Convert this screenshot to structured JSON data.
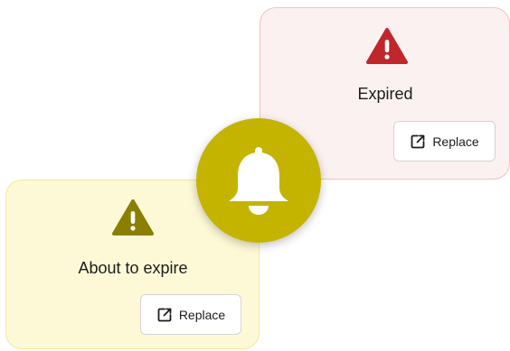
{
  "colors": {
    "expired_accent": "#c0272d",
    "expiring_accent": "#8a7f00",
    "bell_badge": "#c4b400"
  },
  "notification_icon": "bell-icon",
  "cards": {
    "expired": {
      "title": "Expired",
      "icon": "warning-icon",
      "button": {
        "label": "Replace",
        "icon": "open-external-icon"
      }
    },
    "about_to_expire": {
      "title": "About to expire",
      "icon": "warning-icon",
      "button": {
        "label": "Replace",
        "icon": "open-external-icon"
      }
    }
  }
}
